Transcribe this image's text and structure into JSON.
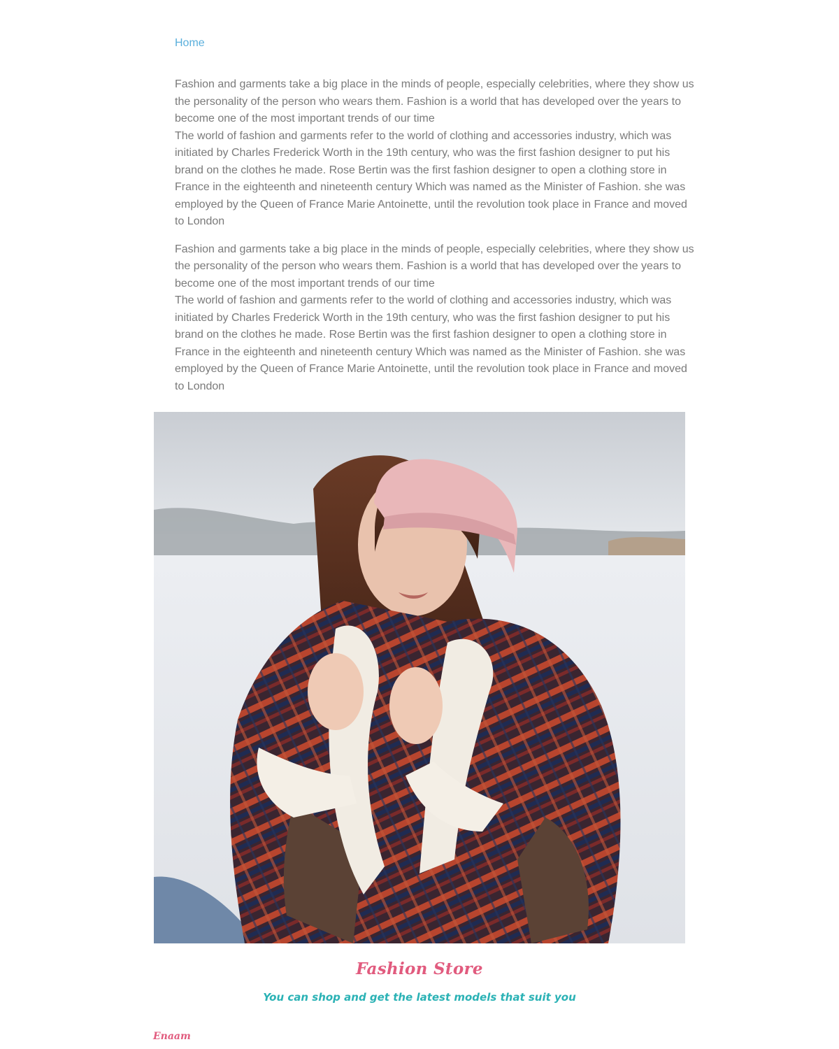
{
  "nav": {
    "breadcrumb": "Home"
  },
  "article": {
    "paragraphs": [
      "Fashion and garments take a big place in the minds of people, especially celebrities, where they show us the personality of the person who wears them. Fashion is a world that has developed over the years to become one of the most important trends of our time",
      "The world of fashion and garments refer to the world of clothing and accessories industry, which was initiated by Charles Frederick Worth in the 19th century, who was the first fashion designer to put his brand on the clothes he made. Rose Bertin was the first fashion designer to open a clothing store in France in the eighteenth and nineteenth century Which was named as the Minister of Fashion. she was employed by the Queen of France Marie Antoinette, until the revolution took place in France and moved to London",
      "Fashion and garments take a big place in the minds of people, especially celebrities, where they show us the personality of the person who wears them. Fashion is a world that has developed over the years to become one of the most important trends of our time",
      "The world of fashion and garments refer to the world of clothing and accessories industry, which was initiated by Charles Frederick Worth in the 19th century, who was the first fashion designer to put his brand on the clothes he made. Rose Bertin was the first fashion designer to open a clothing store in France in the eighteenth and nineteenth century Which was named as the Minister of Fashion. she was employed by the Queen of France Marie Antoinette, until the revolution took place in France and moved to London"
    ]
  },
  "footer": {
    "store_name": "Fashion Store",
    "tagline": "You can shop and get the latest models that suit you",
    "signature": "Enaam"
  },
  "colors": {
    "link": "#5aafdc",
    "body_text": "#7a7a7a",
    "brand_pink": "#e15b7e",
    "brand_teal": "#2bb2b5"
  }
}
